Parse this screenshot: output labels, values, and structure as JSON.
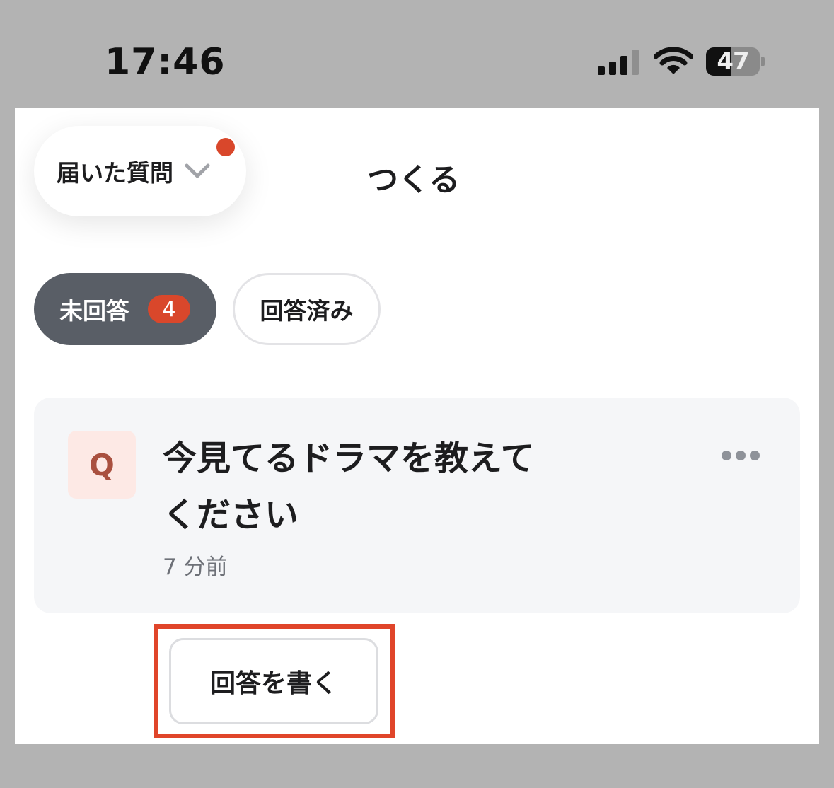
{
  "status_bar": {
    "time": "17:46",
    "battery_percent": "47",
    "battery_level": 0.47,
    "signal_icon": "cellular-signal-icon",
    "wifi_icon": "wifi-icon"
  },
  "header": {
    "dropdown_label": "届いた質問",
    "dropdown_icon": "chevron-down-icon",
    "create_label": "つくる"
  },
  "tabs": [
    {
      "label": "未回答",
      "badge": "4",
      "active": true
    },
    {
      "label": "回答済み",
      "active": false
    }
  ],
  "question": {
    "badge": "Q",
    "text_line1": "今見てるドラマを教えて",
    "text_line2": "ください",
    "time": "7 分前",
    "more_icon": "more-horizontal-icon"
  },
  "answer_button": {
    "label": "回答を書く"
  },
  "colors": {
    "accent_red": "#d9472b",
    "active_tab": "#595e66",
    "card_bg": "#f5f6f8",
    "highlight": "#e0452a"
  }
}
